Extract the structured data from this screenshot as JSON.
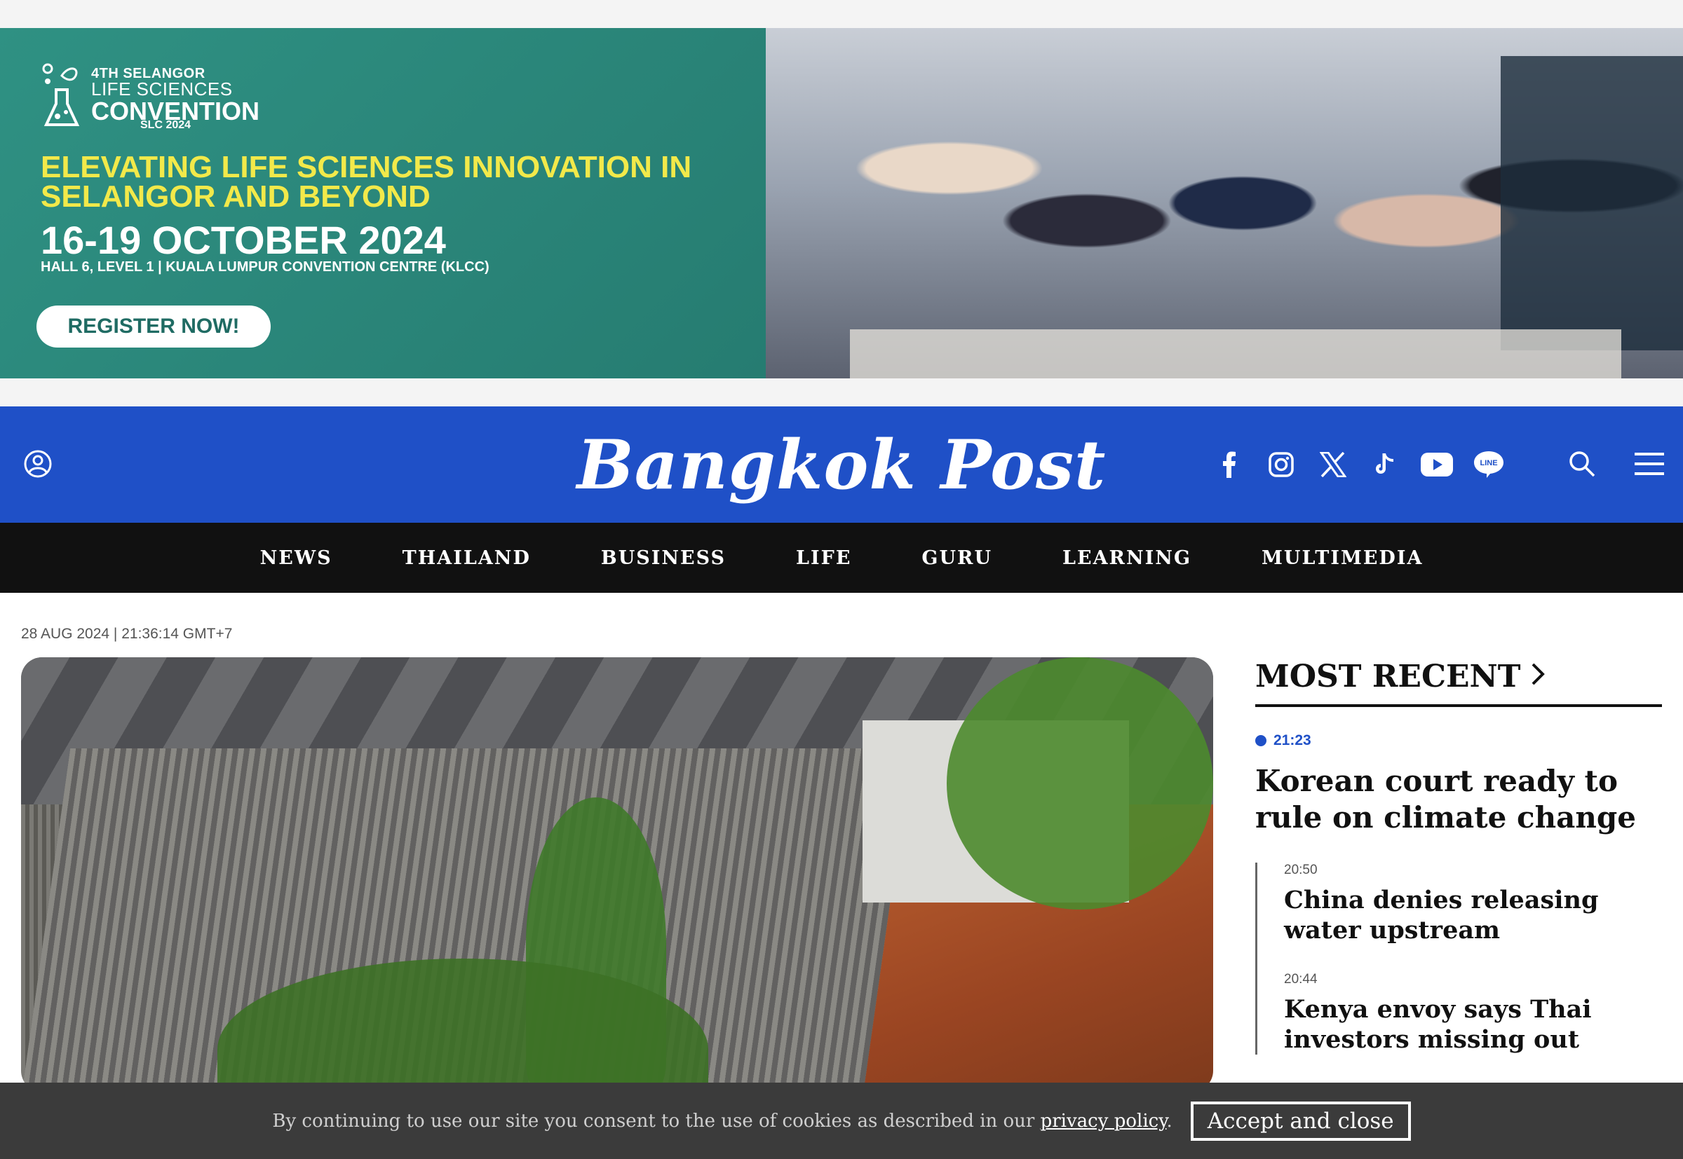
{
  "ad": {
    "kicker": "4TH SELANGOR",
    "name_top": "LIFE SCIENCES",
    "name_big": "CONVENTION",
    "name_sub": "SLC 2024",
    "headline": "ELEVATING LIFE SCIENCES INNOVATION IN SELANGOR AND BEYOND",
    "dates": "16-19 OCTOBER 2024",
    "venue": "HALL 6, LEVEL 1 | KUALA LUMPUR CONVENTION CENTRE (KLCC)",
    "cta": "REGISTER NOW!"
  },
  "header": {
    "brand": "Bangkok Post",
    "social": [
      "facebook-icon",
      "instagram-icon",
      "x-icon",
      "tiktok-icon",
      "youtube-icon",
      "line-icon"
    ],
    "line_label": "LINE",
    "accent_color": "#1f50c7"
  },
  "nav": {
    "items": [
      "NEWS",
      "THAILAND",
      "BUSINESS",
      "LIFE",
      "GURU",
      "LEARNING",
      "MULTIMEDIA"
    ]
  },
  "article": {
    "timestamp": "28 AUG 2024 | 21:36:14 GMT+7"
  },
  "sidebar": {
    "heading": "MOST RECENT",
    "lead": {
      "time": "21:23",
      "title": "Korean court ready to rule on climate change"
    },
    "items": [
      {
        "time": "20:50",
        "title": "China denies releasing water upstream"
      },
      {
        "time": "20:44",
        "title": "Kenya envoy says Thai investors missing out"
      }
    ]
  },
  "cookie": {
    "text": "By continuing to use our site you consent to the use of cookies as described in our",
    "link": "privacy policy",
    "period": ".",
    "button": "Accept and close"
  }
}
